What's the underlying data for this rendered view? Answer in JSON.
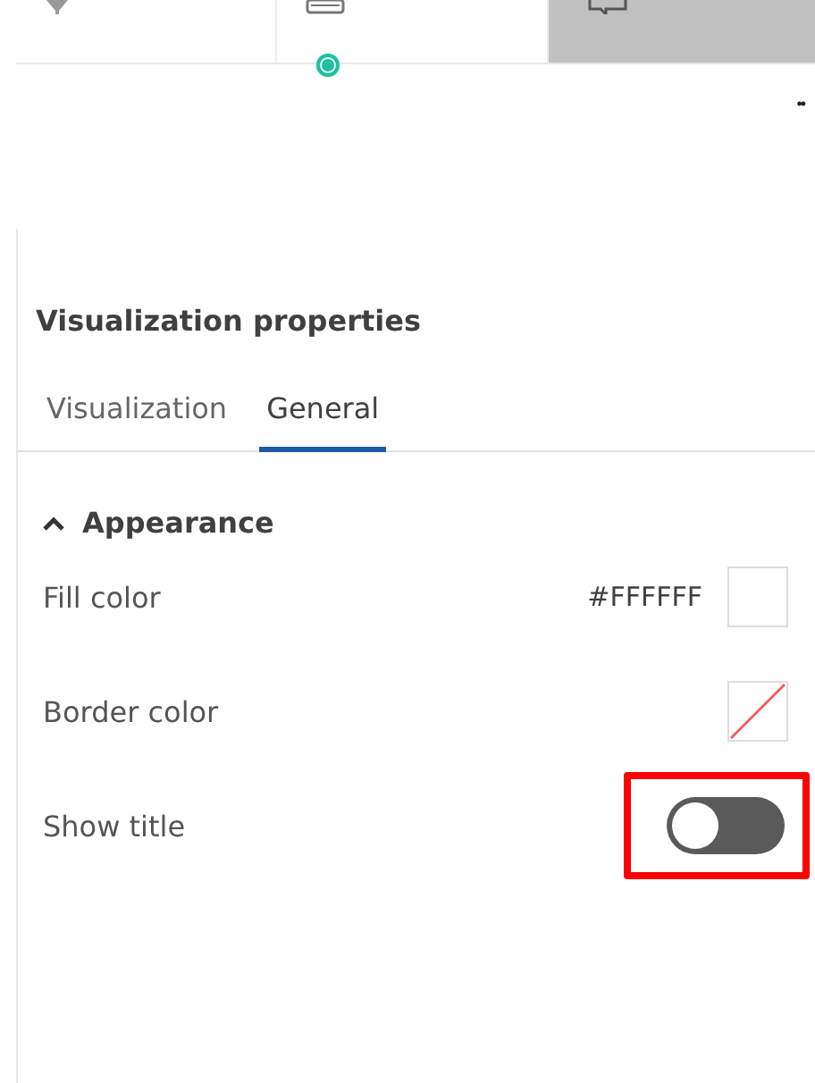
{
  "top_tabs": [
    {
      "selected": false,
      "badge": false
    },
    {
      "selected": false,
      "badge": true
    },
    {
      "selected": true,
      "badge": false
    }
  ],
  "more_button": "••",
  "panel": {
    "title": "Visualization properties",
    "tabs": [
      {
        "label": "Visualization",
        "selected": false
      },
      {
        "label": "General",
        "selected": true
      }
    ],
    "section": {
      "label": "Appearance",
      "expanded": true,
      "rows": [
        {
          "kind": "color",
          "label": "Fill color",
          "value": "#FFFFFF",
          "no_color": false
        },
        {
          "kind": "color",
          "label": "Border color",
          "no_color": true
        },
        {
          "kind": "toggle",
          "label": "Show title",
          "on": false,
          "highlighted": true
        }
      ]
    }
  }
}
